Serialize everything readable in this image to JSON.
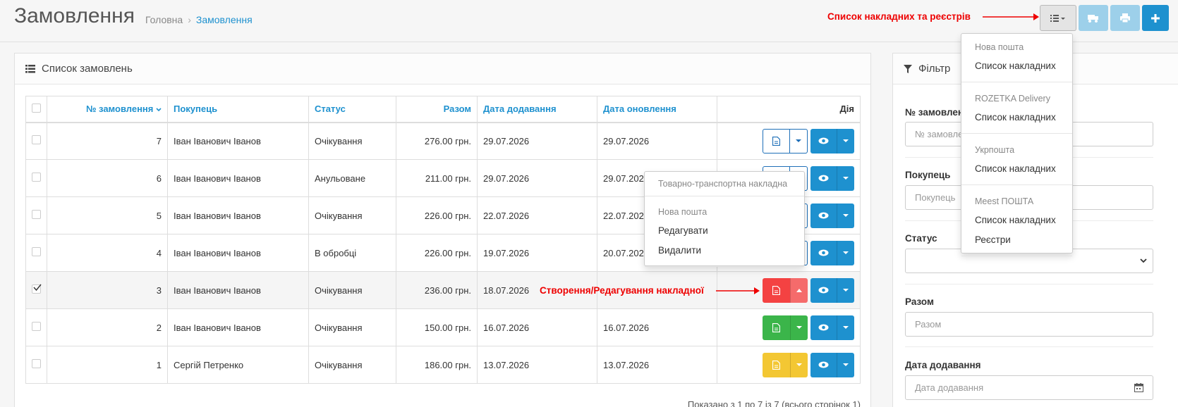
{
  "header": {
    "title": "Замовлення",
    "breadcrumb": [
      "Головна",
      "Замовлення"
    ]
  },
  "orders_panel": {
    "title": "Список замовлень",
    "columns": [
      "№ замовлення",
      "Покупець",
      "Статус",
      "Разом",
      "Дата додавання",
      "Дата оновлення",
      "Дія"
    ],
    "rows": [
      {
        "id": "7",
        "customer": "Іван Іванович Іванов",
        "status": "Очікування",
        "total": "276.00 грн.",
        "added": "29.07.2026",
        "updated": "29.07.2026",
        "waybill": "default"
      },
      {
        "id": "6",
        "customer": "Іван Іванович Іванов",
        "status": "Анульоване",
        "total": "211.00 грн.",
        "added": "29.07.2026",
        "updated": "29.07.2026",
        "waybill": "default"
      },
      {
        "id": "5",
        "customer": "Іван Іванович Іванов",
        "status": "Очікування",
        "total": "226.00 грн.",
        "added": "22.07.2026",
        "updated": "22.07.2026",
        "waybill": "default"
      },
      {
        "id": "4",
        "customer": "Іван Іванович Іванов",
        "status": "В обробці",
        "total": "226.00 грн.",
        "added": "19.07.2026",
        "updated": "20.07.2026",
        "waybill": "default"
      },
      {
        "id": "3",
        "customer": "Іван Іванович Іванов",
        "status": "Очікування",
        "total": "236.00 грн.",
        "added": "18.07.2026",
        "updated": "",
        "waybill": "red",
        "checked": true
      },
      {
        "id": "2",
        "customer": "Іван Іванович Іванов",
        "status": "Очікування",
        "total": "150.00 грн.",
        "added": "16.07.2026",
        "updated": "16.07.2026",
        "waybill": "green"
      },
      {
        "id": "1",
        "customer": "Сергій Петренко",
        "status": "Очікування",
        "total": "186.00 грн.",
        "added": "13.07.2026",
        "updated": "13.07.2026",
        "waybill": "yellow"
      }
    ],
    "pagination_text": "Показано з 1 по 7 із 7 (всього сторінок 1)"
  },
  "row_dropdown": {
    "header1": "Товарно-транспортна накладна",
    "header2": "Нова пошта",
    "items": [
      "Редагувати",
      "Видалити"
    ]
  },
  "toolbar_dropdown": {
    "groups": [
      {
        "header": "Нова пошта",
        "items": [
          "Список накладних"
        ]
      },
      {
        "header": "ROZETKA Delivery",
        "items": [
          "Список накладних"
        ]
      },
      {
        "header": "Укрпошта",
        "items": [
          "Список накладних"
        ]
      },
      {
        "header": "Meest ПОШТА",
        "items": [
          "Список накладних",
          "Реєстри"
        ]
      }
    ]
  },
  "filter_panel": {
    "title": "Фільтр",
    "fields": [
      {
        "label": "№ замовлення",
        "placeholder": "№ замовлення"
      },
      {
        "label": "Покупець",
        "placeholder": "Покупець"
      },
      {
        "label": "Статус",
        "placeholder": ""
      },
      {
        "label": "Разом",
        "placeholder": "Разом"
      },
      {
        "label": "Дата додавання",
        "placeholder": "Дата додавання"
      }
    ]
  },
  "annotations": {
    "toolbar": "Список накладних та реєстрів",
    "waybill": "Створення/Редагування накладної"
  },
  "colors": {
    "accent": "#1e91cf",
    "danger": "#f44242",
    "success": "#3bb54a",
    "warning": "#f3c733",
    "annotation": "#e00000"
  }
}
